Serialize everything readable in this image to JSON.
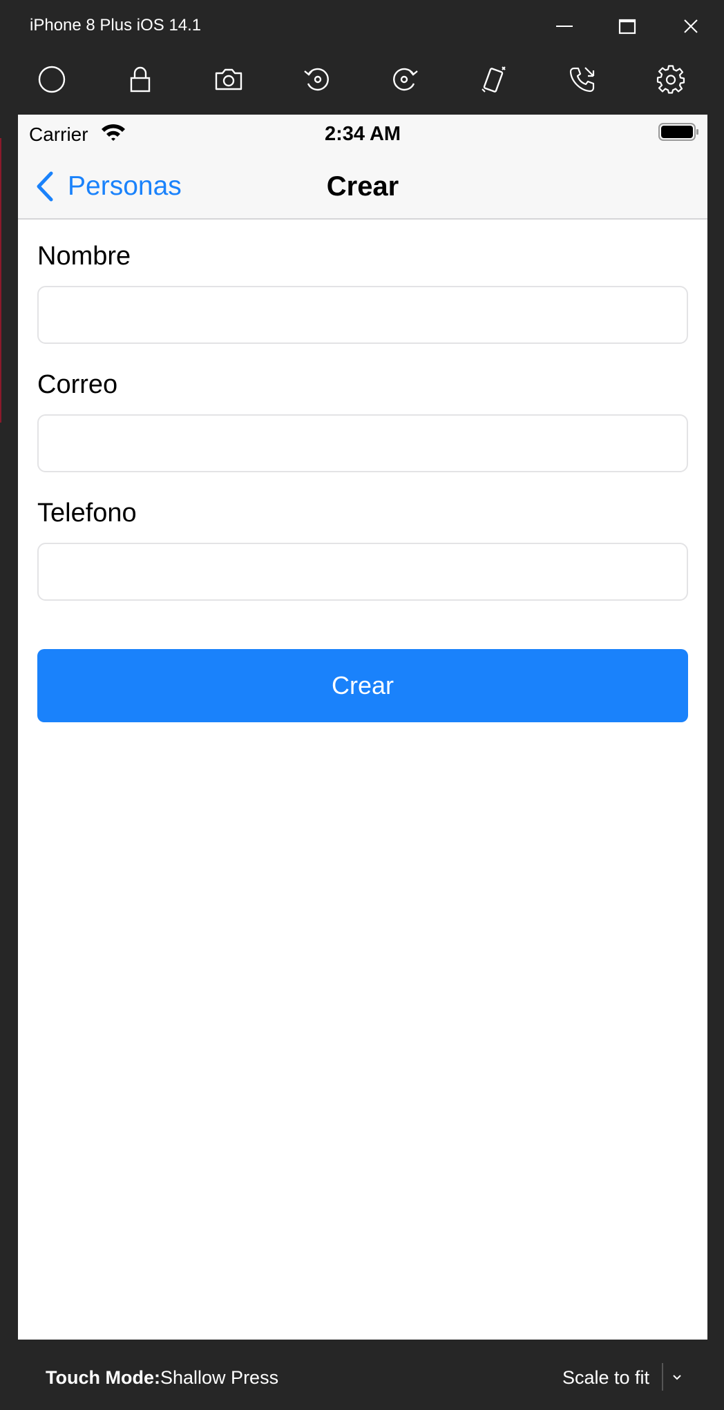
{
  "window": {
    "title": "iPhone 8 Plus iOS 14.1",
    "controls": [
      "minimize-icon",
      "maximize-icon",
      "close-icon"
    ]
  },
  "toolbar": {
    "items": [
      "home-icon",
      "lock-icon",
      "camera-icon",
      "rotate-left-icon",
      "rotate-right-icon",
      "shake-icon",
      "call-icon",
      "gear-icon"
    ]
  },
  "statusbar": {
    "carrier": "Carrier",
    "time": "2:34 AM"
  },
  "navbar": {
    "back_label": "Personas",
    "title": "Crear"
  },
  "form": {
    "fields": [
      {
        "label": "Nombre",
        "value": ""
      },
      {
        "label": "Correo",
        "value": ""
      },
      {
        "label": "Telefono",
        "value": ""
      }
    ],
    "submit_label": "Crear"
  },
  "bottombar": {
    "touch_mode_label": "Touch Mode:",
    "touch_mode_value": "Shallow Press",
    "scale_value": "Scale to fit"
  },
  "colors": {
    "accent": "#1a82fb",
    "chrome_background": "#262626",
    "navbar_background": "#f7f7f7"
  }
}
